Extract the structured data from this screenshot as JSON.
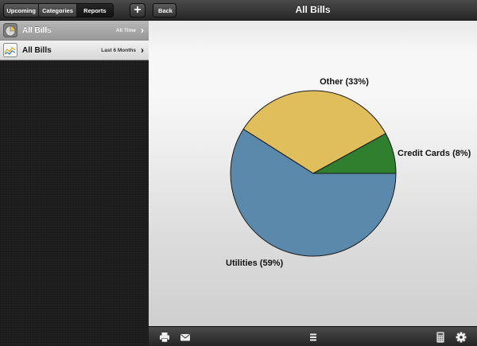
{
  "sidebar": {
    "segments": [
      {
        "label": "Upcoming",
        "active": false
      },
      {
        "label": "Categories",
        "active": false
      },
      {
        "label": "Reports",
        "active": true
      }
    ],
    "add_label": "+",
    "reports": [
      {
        "title": "All Bills",
        "subtitle": "All Time",
        "icon": "pie-chart-icon",
        "selected": true
      },
      {
        "title": "All Bills",
        "subtitle": "Last 6 Months",
        "icon": "line-chart-icon",
        "selected": false
      }
    ]
  },
  "main": {
    "back_label": "Back",
    "title": "All Bills"
  },
  "toolbar": {
    "icons": [
      "print-icon",
      "mail-icon",
      "list-icon",
      "calculator-icon",
      "gear-icon"
    ]
  },
  "colors": {
    "utilities": "#5b89ab",
    "other": "#e1be5c",
    "credit_cards": "#2f7f2f",
    "selected_row": "#a8a8a8"
  },
  "chart_data": {
    "type": "pie",
    "series": [
      {
        "name": "Utilities",
        "value": 59,
        "label": "Utilities (59%)"
      },
      {
        "name": "Other",
        "value": 33,
        "label": "Other (33%)"
      },
      {
        "name": "Credit Cards",
        "value": 8,
        "label": "Credit Cards (8%)"
      }
    ],
    "start_angle_deg": 0,
    "direction": "clockwise"
  }
}
